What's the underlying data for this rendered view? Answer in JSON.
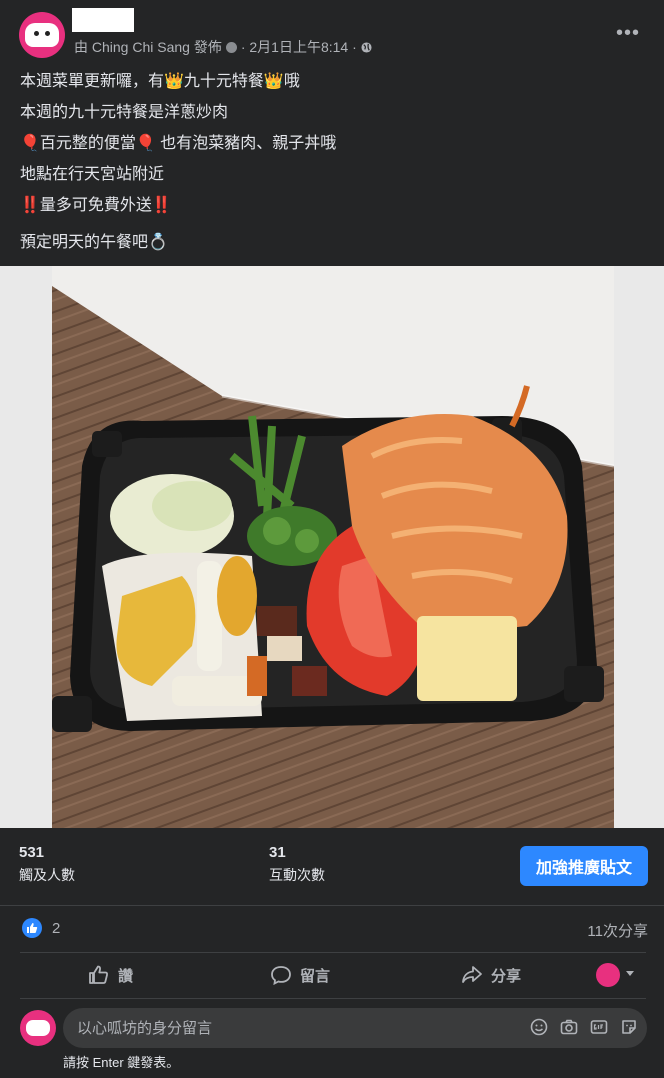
{
  "header": {
    "meta_by": "由 Ching Chi Sang 發佈",
    "meta_date": "· 2月1日上午8:14 ·",
    "more_label": "•••"
  },
  "post": {
    "lines": [
      "本週菜單更新囉，有👑九十元特餐👑哦",
      "本週的九十元特餐是洋蔥炒肉",
      "🎈百元整的便當🎈 也有泡菜豬肉、親子丼哦",
      "地點在行天宮站附近",
      "‼️量多可免費外送‼️",
      "預定明天的午餐吧💍"
    ]
  },
  "stats": {
    "reach_num": "531",
    "reach_label": "觸及人數",
    "engage_num": "31",
    "engage_label": "互動次數",
    "boost_label": "加強推廣貼文"
  },
  "reactions": {
    "count": "2",
    "shares": "11次分享"
  },
  "actions": {
    "like": "讚",
    "comment": "留言",
    "share": "分享"
  },
  "comment": {
    "placeholder": "以心呱坊的身分留言",
    "hint": "請按 Enter 鍵發表。"
  },
  "colors": {
    "background": "#242526",
    "accent": "#2d88ff",
    "brand_pink": "#e8307f"
  }
}
